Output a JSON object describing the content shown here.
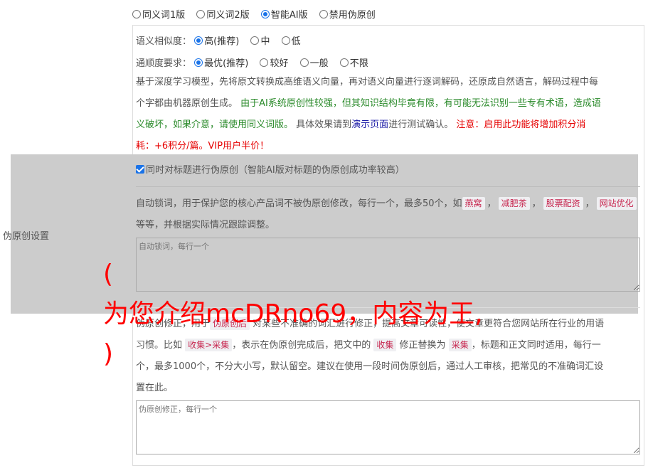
{
  "mode": {
    "options": [
      "同义词1版",
      "同义词2版",
      "智能AI版",
      "禁用伪原创"
    ],
    "selected_index": 2
  },
  "similarity": {
    "label": "语义相似度：",
    "options": [
      "高(推荐)",
      "中",
      "低"
    ],
    "selected_index": 0
  },
  "fluency": {
    "label": "通顺度要求：",
    "options": [
      "最优(推荐)",
      "较好",
      "一般",
      "不限"
    ],
    "selected_index": 0
  },
  "description": {
    "line1": "基于深度学习模型，先将原文转换成高维语义向量，再对语义向量进行逐词解码，还原成自然语言，解码过程中每",
    "line2_a": "个字都由机器原创生成。",
    "line2_green": "由于AI系统原创性较强，但其知识结构毕竟有限，有可能无法识别一些专有术语，造成语",
    "line3_green": "义破坏，如果介意，请使用同义词版。",
    "line3_b": "具体效果请到",
    "link": "演示页面",
    "line3_c": "进行测试确认。",
    "line3_red": "注意：启用此功能将增加积分消",
    "line4_red": "耗：+6积分/篇。VIP用户半价！"
  },
  "title_checkbox": {
    "label": "同时对标题进行伪原创（智能AI版对标题的伪原创成功率较高）",
    "checked": true
  },
  "side_label": "伪原创设置",
  "lock": {
    "text_a": "自动锁词，用于保护您的核心产品词不被伪原创修改，每行一个，最多50个，如",
    "tags": [
      "燕窝",
      "减肥茶",
      "股票配资",
      "网站优化"
    ],
    "tag_sep": "，",
    "text_b": "等等，并根据实际情况跟踪调整。",
    "placeholder": "自动锁词，每行一个"
  },
  "fix": {
    "text_a": "伪原创修正，用于",
    "tag1": "伪原创后",
    "text_b": "对某些不准确的词汇进行修正，提高文章可读性，使文章更符合您网站所在行业的用语",
    "text_c": "习惯。比如",
    "tag2": "收集>采集",
    "text_d": "，表示在伪原创完成后，把文中的",
    "tag3": "收集",
    "text_e": "修正替换为",
    "tag4": "采集",
    "text_f": "，标题和正文同时适用，每行一",
    "text_g": "个，最多1000个，不分大小写，默认留空。建议在使用一段时间伪原创后，通过人工审核，把常见的不准确词汇设",
    "text_h": "置在此。",
    "placeholder": "伪原创修正，每行一个"
  },
  "watermark": {
    "line1": "(",
    "line2": "为您介绍mcDRno69，内容为王,",
    "line3": ")"
  }
}
